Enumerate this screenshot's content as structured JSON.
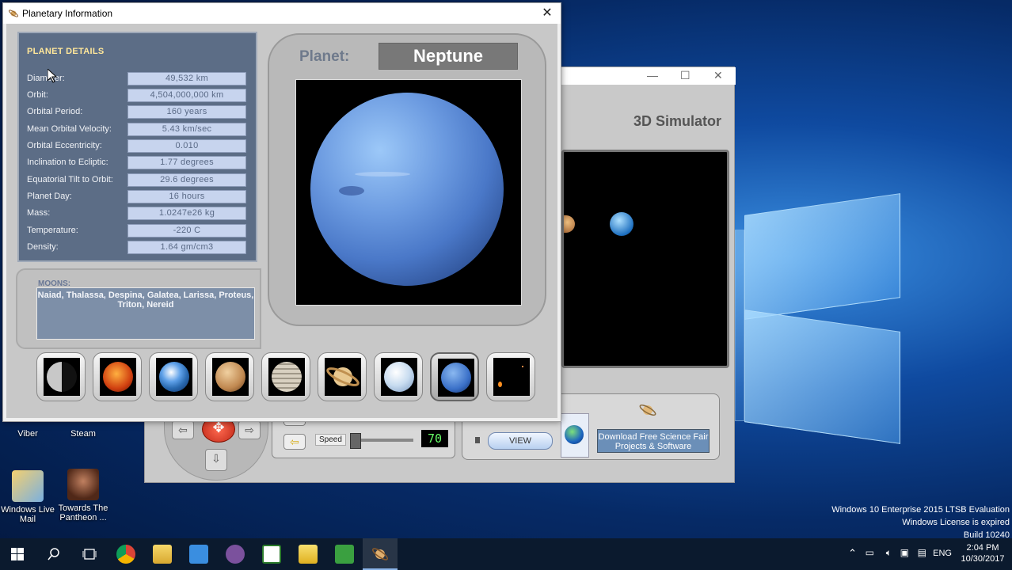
{
  "window": {
    "title": "Planetary Information",
    "close_glyph": "✕"
  },
  "details": {
    "heading": "PLANET DETAILS",
    "rows": [
      {
        "label": "Diameter:",
        "value": "49,532 km"
      },
      {
        "label": "Orbit:",
        "value": "4,504,000,000 km"
      },
      {
        "label": "Orbital Period:",
        "value": "160 years"
      },
      {
        "label": "Mean Orbital Velocity:",
        "value": "5.43 km/sec"
      },
      {
        "label": "Orbital  Eccentricity:",
        "value": "0.010"
      },
      {
        "label": "Inclination to Ecliptic:",
        "value": "1.77 degrees"
      },
      {
        "label": "Equatorial Tilt to Orbit:",
        "value": "29.6 degrees"
      },
      {
        "label": "Planet Day:",
        "value": "16 hours"
      },
      {
        "label": "Mass:",
        "value": "1.0247e26 kg"
      },
      {
        "label": "Temperature:",
        "value": "-220 C"
      },
      {
        "label": "Density:",
        "value": "1.64 gm/cm3"
      }
    ]
  },
  "moons": {
    "label": "MOONS:",
    "list": "Naiad, Thalassa, Despina, Galatea, Larissa, Proteus, Triton, Nereid"
  },
  "viewer": {
    "label": "Planet:",
    "planet_name": "Neptune"
  },
  "thumbnails": [
    {
      "name": "mercury",
      "selected": false
    },
    {
      "name": "venus",
      "selected": false
    },
    {
      "name": "earth",
      "selected": false
    },
    {
      "name": "mars",
      "selected": false
    },
    {
      "name": "jupiter",
      "selected": false
    },
    {
      "name": "saturn",
      "selected": false
    },
    {
      "name": "uranus",
      "selected": false
    },
    {
      "name": "neptune",
      "selected": true
    },
    {
      "name": "pluto",
      "selected": false
    }
  ],
  "simulator": {
    "title": "3D Simulator",
    "speed_label": "Speed",
    "speed_value": "70",
    "view_label": "VIEW",
    "download_text": "Download Free Science Fair Projects & Software",
    "minimize_glyph": "—",
    "maximize_glyph": "☐",
    "close_glyph": "✕"
  },
  "desktop": {
    "icons": [
      {
        "label": "Viber"
      },
      {
        "label": "Steam"
      },
      {
        "label": "Windows Live Mail"
      },
      {
        "label": "Towards The Pantheon ..."
      }
    ],
    "watermark": [
      "Windows 10 Enterprise 2015 LTSB Evaluation",
      "Windows License is expired",
      "Build 10240"
    ]
  },
  "taskbar": {
    "language": "ENG",
    "time": "2:04 PM",
    "date": "10/30/2017"
  }
}
